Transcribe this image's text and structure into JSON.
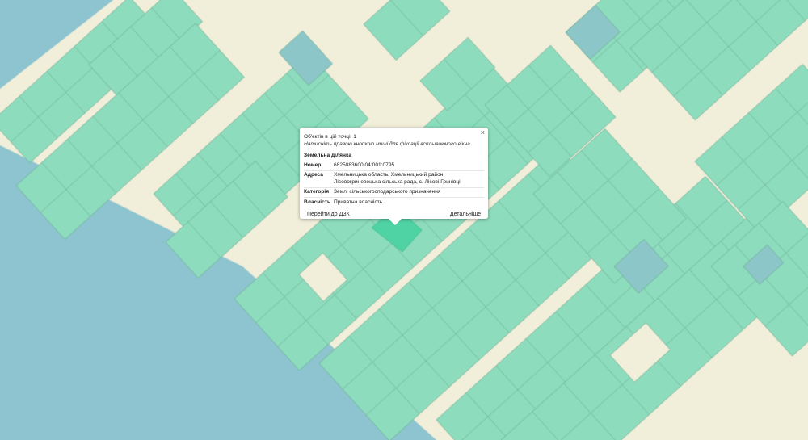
{
  "map": {
    "colors": {
      "background": "#f1eed9",
      "parcel": "#8ddcbd",
      "parcel_alt": "#8cc6c8",
      "parcel_selected": "#4fd3a4",
      "parcel_border": "#6aaa92",
      "water": "#8ec4d0"
    }
  },
  "popup": {
    "objects_count": "Об'єктів в цій точці: 1",
    "hint": "Натисніть правою кнопкою миші для фіксації всплываючого вікна",
    "section_title": "Земельна ділянка",
    "rows": [
      {
        "key": "Номер",
        "value": "6825083600:04:001:0795"
      },
      {
        "key": "Адреса",
        "value": "Хмельницька область, Хмельницький район, Лісовогриневецька сільська рада, с. Лісові Гринівці"
      },
      {
        "key": "Категорія",
        "value": "Землі сільськогосподарського призначення"
      },
      {
        "key": "Власність",
        "value": "Приватна власність"
      }
    ],
    "close_label": "×",
    "link_dzk": "Перейти до ДЗК",
    "link_details": "Детальніше"
  }
}
